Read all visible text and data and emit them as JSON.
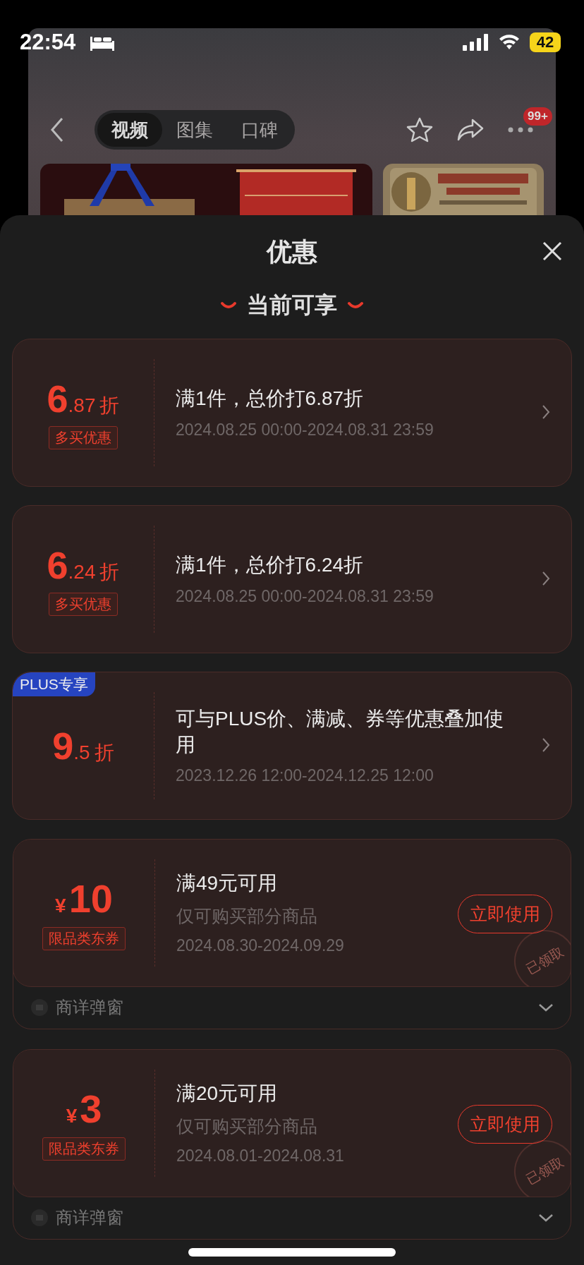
{
  "status_bar": {
    "time": "22:54",
    "battery": "42"
  },
  "header": {
    "tabs": [
      {
        "label": "视频",
        "selected": true
      },
      {
        "label": "图集",
        "selected": false
      },
      {
        "label": "口碑",
        "selected": false
      }
    ],
    "more_badge": "99+"
  },
  "sheet": {
    "title": "优惠",
    "section": "当前可享",
    "offers": [
      {
        "kind": "discount",
        "whole": "6",
        "fraction": ".87",
        "unit": "折",
        "tag": "多买优惠",
        "title": "满1件，总价打6.87折",
        "period": "2024.08.25 00:00-2024.08.31 23:59"
      },
      {
        "kind": "discount",
        "whole": "6",
        "fraction": ".24",
        "unit": "折",
        "tag": "多买优惠",
        "title": "满1件，总价打6.24折",
        "period": "2024.08.25 00:00-2024.08.31 23:59"
      },
      {
        "kind": "discount",
        "badge": "PLUS专享",
        "whole": "9",
        "fraction": ".5",
        "unit": "折",
        "title": "可与PLUS价、满减、券等优惠叠加使用",
        "period": "2023.12.26 12:00-2024.12.25 12:00"
      },
      {
        "kind": "coupon",
        "currency": "¥",
        "amount": "10",
        "tag": "限品类东券",
        "title": "满49元可用",
        "note": "仅可购买部分商品",
        "period": "2024.08.30-2024.09.29",
        "button": "立即使用",
        "stamp": "已领取",
        "footer": "商详弹窗"
      },
      {
        "kind": "coupon",
        "currency": "¥",
        "amount": "3",
        "tag": "限品类东券",
        "title": "满20元可用",
        "note": "仅可购买部分商品",
        "period": "2024.08.01-2024.08.31",
        "button": "立即使用",
        "stamp": "已领取",
        "footer": "商详弹窗"
      }
    ]
  }
}
